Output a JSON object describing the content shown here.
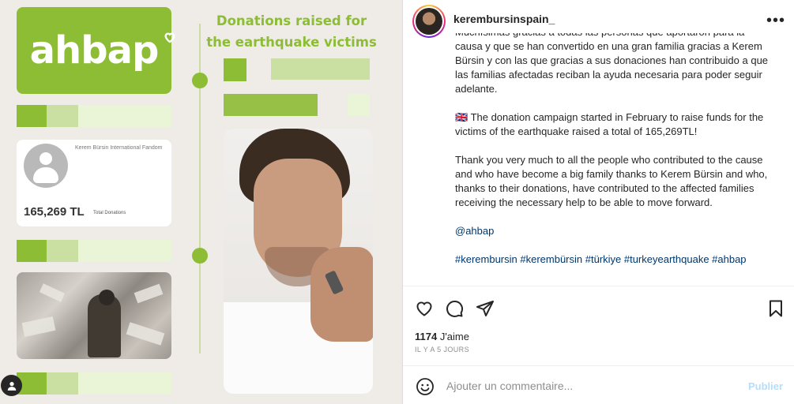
{
  "image": {
    "logo_text": "ahbap",
    "headline": "Donations raised for the earthquake victims",
    "fund_card": {
      "name": "Kerem Bürsin International Fandom",
      "amount": "165,269 TL",
      "amount_label": "Total Donations"
    },
    "colors": {
      "green": "#8cbd34",
      "light_green": "#c9e0a2",
      "pale_green": "#eaf4d6",
      "background": "#efece8"
    }
  },
  "panel": {
    "username": "kerembursinspain_",
    "more_icon": "more-horizontal-icon",
    "caption": [
      "Muchísimas gracias a todas las personas que aportaron para la causa y que se han convertido en una gran familia gracias a Kerem Bürsin y con las que gracias a sus donaciones han contribuido a que las familias afectadas reciban la ayuda necesaria para poder seguir adelante.",
      "🇬🇧 The donation campaign started in February to raise funds for the victims of the earthquake raised a total of 165,269TL!",
      "Thank you very much to all the people who contributed to the cause and who have become a big family thanks to Kerem Bürsin and who, thanks to their donations, have contributed to the affected families receiving the necessary help to be able to move forward.",
      "@ahbap",
      "#kerembursin #kerembürsin #türkiye #turkeyearthquake #ahbap"
    ],
    "likes_count": "1174",
    "likes_label": "J'aime",
    "timestamp": "IL Y A 5 JOURS",
    "comment_placeholder": "Ajouter un commentaire...",
    "publish_label": "Publier",
    "icons": [
      "heart-icon",
      "comment-icon",
      "share-icon",
      "bookmark-icon",
      "emoji-icon"
    ]
  }
}
